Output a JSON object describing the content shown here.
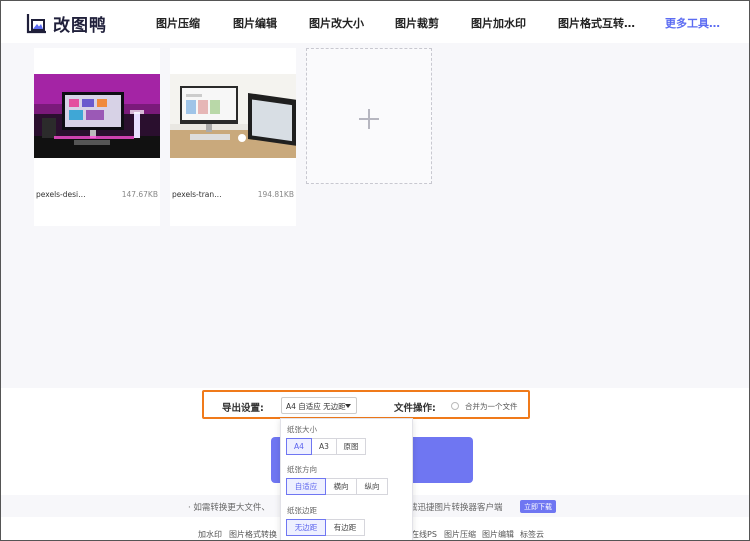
{
  "app": {
    "name": "改图鸭",
    "brand_color": "#6f76f2",
    "highlight_color": "#f07a1a"
  },
  "nav": {
    "items": [
      {
        "label": "图片压缩"
      },
      {
        "label": "图片编辑"
      },
      {
        "label": "图片改大小"
      },
      {
        "label": "图片裁剪"
      },
      {
        "label": "图片加水印"
      },
      {
        "label": "图片格式互转…"
      }
    ],
    "more": "更多工具…"
  },
  "files": [
    {
      "name": "pexels-desi…",
      "size": "147.67KB"
    },
    {
      "name": "pexels-tran…",
      "size": "194.81KB"
    }
  ],
  "export": {
    "label": "导出设置:",
    "selected": "A4 自适应 无边距",
    "file_label": "文件操作:",
    "merge_label": "合并为一个文件"
  },
  "dropdown": {
    "paper_size": {
      "title": "纸张大小",
      "options": [
        "A4",
        "A3",
        "原图"
      ],
      "selected": "A4"
    },
    "orientation": {
      "title": "纸张方向",
      "options": [
        "自适应",
        "横向",
        "纵向"
      ],
      "selected": "自适应"
    },
    "margin": {
      "title": "纸张边距",
      "options": [
        "无边距",
        "有边距"
      ],
      "selected": "无边距"
    }
  },
  "promo": {
    "left": "· 如需转换更大文件、",
    "right": "载迅捷图片转换器客户端",
    "download": "立即下载"
  },
  "footer_links": [
    {
      "label": "加水印"
    },
    {
      "label": "图片格式转换"
    },
    {
      "label": "在线PS"
    },
    {
      "label": "图片压缩"
    },
    {
      "label": "图片编辑"
    },
    {
      "label": "标签云"
    }
  ]
}
